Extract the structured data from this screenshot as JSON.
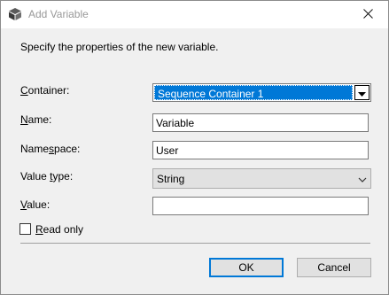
{
  "window": {
    "title": "Add Variable",
    "close_glyph": "✕"
  },
  "instructions": "Specify the properties of the new variable.",
  "form": {
    "container": {
      "label_mnemonic": "C",
      "label_rest": "ontainer:",
      "value": "Sequence Container 1"
    },
    "name": {
      "label_mnemonic": "N",
      "label_rest": "ame:",
      "value": "Variable"
    },
    "namespace": {
      "label_pre": "Name",
      "label_mnemonic": "s",
      "label_rest": "pace:",
      "value": "User"
    },
    "value_type": {
      "label_pre": "Value ",
      "label_mnemonic": "t",
      "label_rest": "ype:",
      "value": "String"
    },
    "value": {
      "label_mnemonic": "V",
      "label_rest": "alue:",
      "value": ""
    },
    "read_only": {
      "label_mnemonic": "R",
      "label_rest": "ead only",
      "checked": false
    }
  },
  "buttons": {
    "ok": "OK",
    "cancel": "Cancel"
  },
  "colors": {
    "selection": "#0078d7",
    "title_text": "#999999"
  },
  "icons": {
    "title": "package-icon",
    "close": "close-icon",
    "dropdown": "chevron-down-icon"
  }
}
